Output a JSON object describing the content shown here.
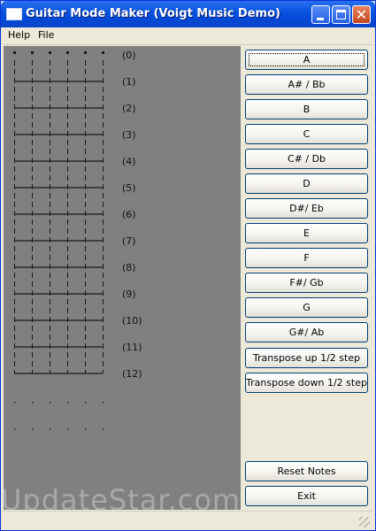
{
  "window": {
    "title": "Guitar Mode Maker (Voigt Music Demo)",
    "close_glyph": "✕"
  },
  "menu": {
    "help": "Help",
    "file": "File"
  },
  "fretboard": {
    "strings": 6,
    "fret_labels": [
      "(0)",
      "(1)",
      "(2)",
      "(3)",
      "(4)",
      "(5)",
      "(6)",
      "(7)",
      "(8)",
      "(9)",
      "(10)",
      "(11)",
      "(12)"
    ]
  },
  "note_buttons": [
    "A",
    "A# / Bb",
    "B",
    "C",
    "C# / Db",
    "D",
    "D#/ Eb",
    "E",
    "F",
    "F#/ Gb",
    "G",
    "G#/ Ab"
  ],
  "transpose": {
    "up": "Transpose up 1/2 step",
    "down": "Transpose down 1/2 step"
  },
  "footer_buttons": {
    "reset": "Reset Notes",
    "exit": "Exit"
  },
  "watermark": "UpdateStar.com",
  "colors": {
    "titlebar": "#0148d6",
    "panel": "#808080",
    "window": "#ece9d8",
    "close": "#c4461f"
  }
}
